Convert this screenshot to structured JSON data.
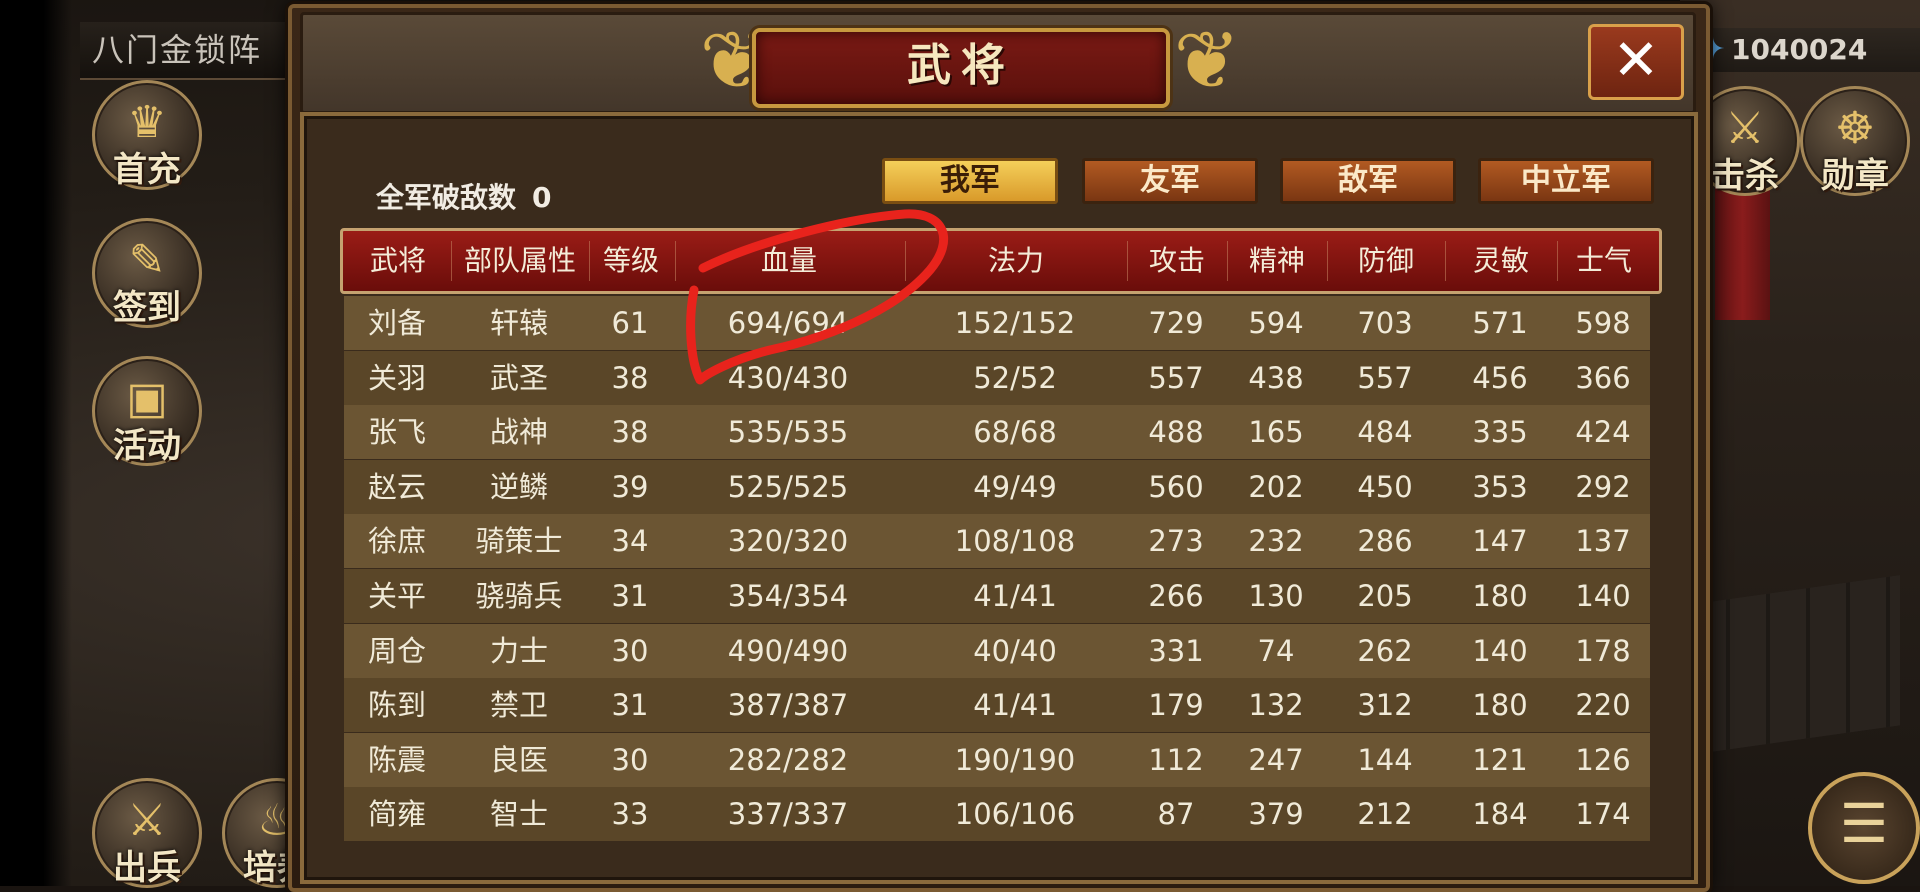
{
  "map_title": "八门金锁阵",
  "currency": {
    "value": "1040024"
  },
  "side_menu": [
    "首充",
    "签到",
    "活动",
    "出兵",
    "培养"
  ],
  "right_menu": [
    "击杀",
    "勋章"
  ],
  "window": {
    "title": "武将",
    "close_label": "✕"
  },
  "kills": {
    "label": "全军破敌数",
    "value": "0"
  },
  "tabs": [
    {
      "label": "我军",
      "active": true
    },
    {
      "label": "友军",
      "active": false
    },
    {
      "label": "敌军",
      "active": false
    },
    {
      "label": "中立军",
      "active": false
    }
  ],
  "table": {
    "headers": [
      "武将",
      "部队属性",
      "等级",
      "血量",
      "法力",
      "攻击",
      "精神",
      "防御",
      "灵敏",
      "士气"
    ],
    "rows": [
      [
        "刘备",
        "轩辕",
        "61",
        "694/694",
        "152/152",
        "729",
        "594",
        "703",
        "571",
        "598"
      ],
      [
        "关羽",
        "武圣",
        "38",
        "430/430",
        "52/52",
        "557",
        "438",
        "557",
        "456",
        "366"
      ],
      [
        "张飞",
        "战神",
        "38",
        "535/535",
        "68/68",
        "488",
        "165",
        "484",
        "335",
        "424"
      ],
      [
        "赵云",
        "逆鳞",
        "39",
        "525/525",
        "49/49",
        "560",
        "202",
        "450",
        "353",
        "292"
      ],
      [
        "徐庶",
        "骑策士",
        "34",
        "320/320",
        "108/108",
        "273",
        "232",
        "286",
        "147",
        "137"
      ],
      [
        "关平",
        "骁骑兵",
        "31",
        "354/354",
        "41/41",
        "266",
        "130",
        "205",
        "180",
        "140"
      ],
      [
        "周仓",
        "力士",
        "30",
        "490/490",
        "40/40",
        "331",
        "74",
        "262",
        "140",
        "178"
      ],
      [
        "陈到",
        "禁卫",
        "31",
        "387/387",
        "41/41",
        "179",
        "132",
        "312",
        "180",
        "220"
      ],
      [
        "陈震",
        "良医",
        "30",
        "282/282",
        "190/190",
        "112",
        "247",
        "144",
        "121",
        "126"
      ],
      [
        "简雍",
        "智士",
        "33",
        "337/337",
        "106/106",
        "87",
        "379",
        "212",
        "184",
        "174"
      ]
    ]
  },
  "colors": {
    "header_red": "#9a1c16",
    "active_tab": "#f4cf5a",
    "inactive_tab": "#b25a22",
    "annotation": "#e8231c"
  },
  "icons": {
    "currency": "feather-icon",
    "close": "close-icon",
    "menu": "menu-icon"
  }
}
